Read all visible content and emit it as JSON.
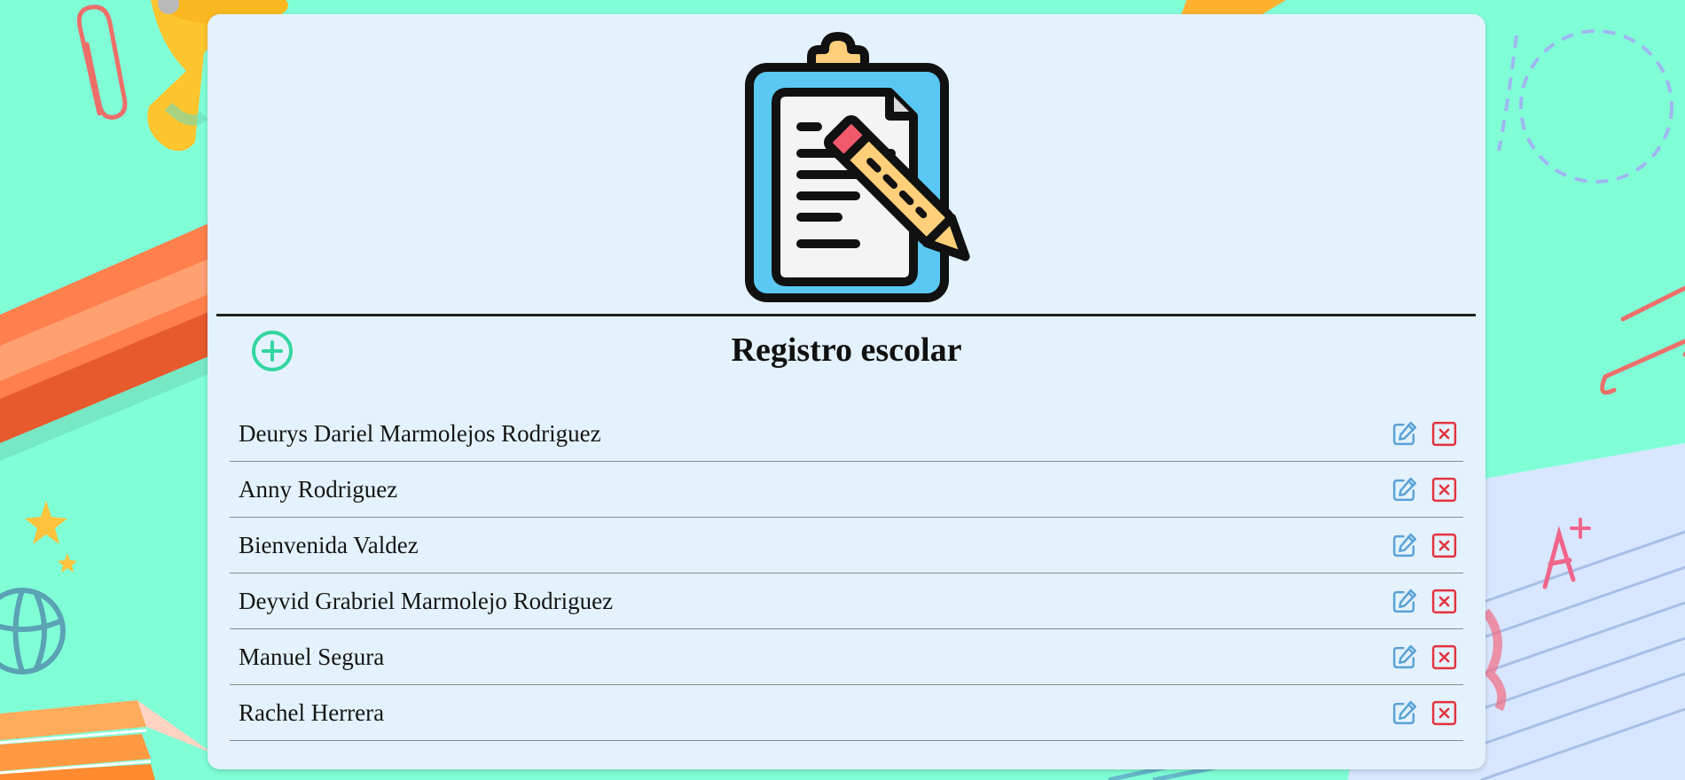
{
  "header": {
    "logo_icon": "clipboard-pencil-icon",
    "title": "Registro escolar"
  },
  "toolbar": {
    "add_icon": "plus-circle-icon"
  },
  "students": [
    {
      "name": "Deurys Dariel Marmolejos Rodriguez"
    },
    {
      "name": "Anny Rodriguez"
    },
    {
      "name": "Bienvenida Valdez"
    },
    {
      "name": "Deyvid Grabriel Marmolejo Rodriguez"
    },
    {
      "name": "Manuel Segura"
    },
    {
      "name": "Rachel Herrera"
    }
  ],
  "row_actions": {
    "edit_icon": "edit-icon",
    "delete_icon": "delete-icon"
  },
  "colors": {
    "background": "#80ffd7",
    "card": "#e4f2fe",
    "add_accent": "#34d6a0",
    "edit_accent": "#5aa2d8",
    "delete_accent": "#e3323c"
  }
}
